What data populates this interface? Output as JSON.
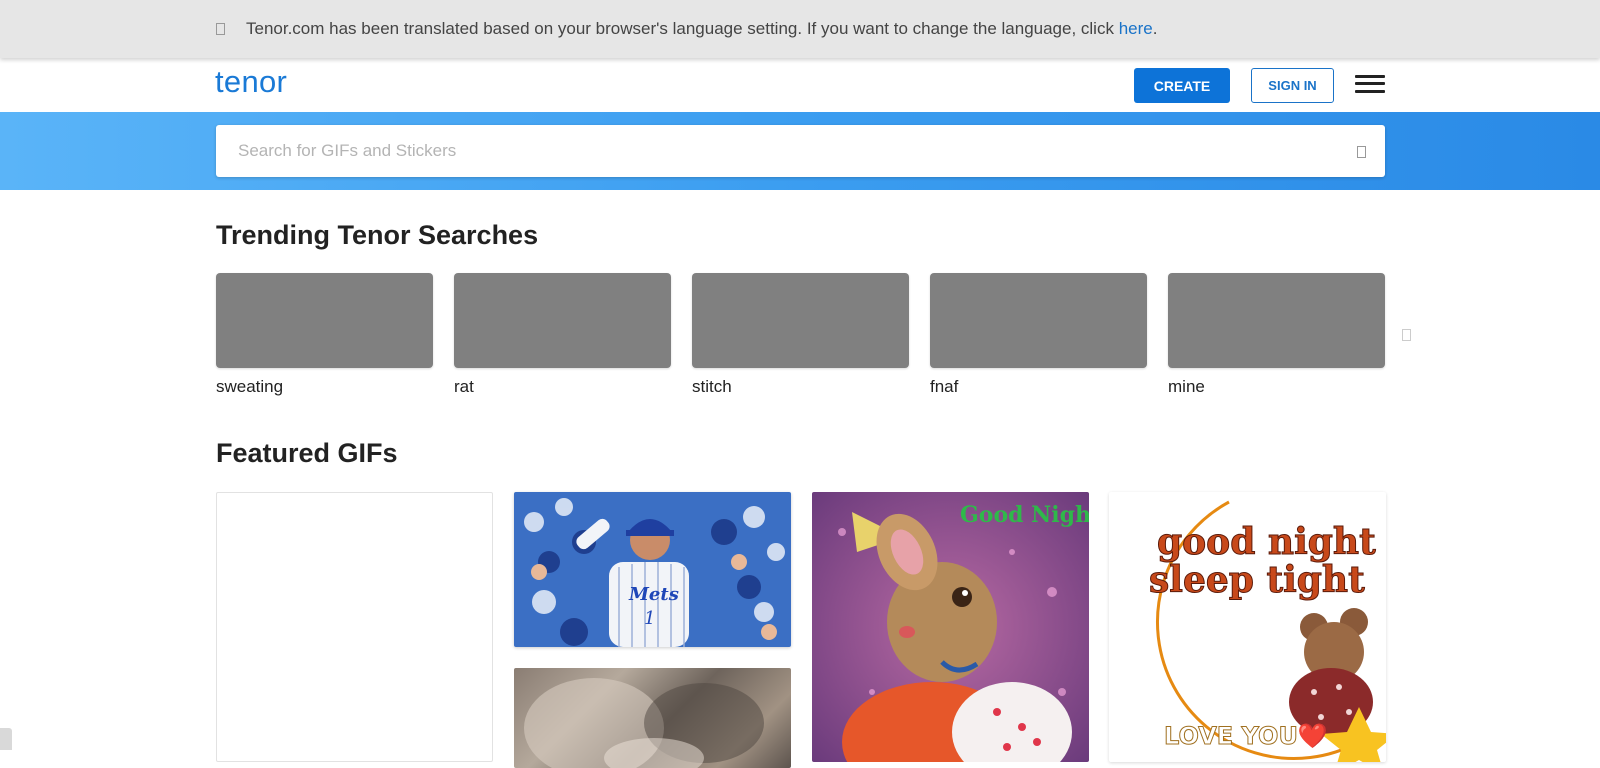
{
  "banner": {
    "icon": "translate-icon",
    "message_prefix": "Tenor.com has been translated based on your browser's language setting. If you want to change the language, click ",
    "link_text": "here",
    "message_suffix": "."
  },
  "header": {
    "logo": "tenor",
    "create_label": "CREATE",
    "signin_label": "SIGN IN",
    "menu_icon": "hamburger-menu-icon"
  },
  "search": {
    "placeholder": "Search for GIFs and Stickers",
    "value": "",
    "icon": "search-icon"
  },
  "trending": {
    "title": "Trending Tenor Searches",
    "items": [
      {
        "label": "sweating"
      },
      {
        "label": "rat"
      },
      {
        "label": "stitch"
      },
      {
        "label": "fnaf"
      },
      {
        "label": "mine"
      }
    ],
    "next_icon": "chevron-right-icon"
  },
  "featured": {
    "title": "Featured GIFs",
    "gifs": [
      {
        "name": "blank-gif"
      },
      {
        "name": "mets-player-celebration-gif",
        "text": "Mets 1"
      },
      {
        "name": "cat-closeup-gif"
      },
      {
        "name": "good-night-mouse-gif",
        "text": "Good Night"
      },
      {
        "name": "good-night-sleep-tight-teddy-gif",
        "line1": "good night",
        "line2": "sleep tight",
        "footer": "LOVE YOU❤️"
      }
    ]
  },
  "colors": {
    "brand": "#1a7ad6",
    "create_bg": "#0d73d8",
    "link": "#1a73c8",
    "placeholder_thumb": "#808080"
  }
}
